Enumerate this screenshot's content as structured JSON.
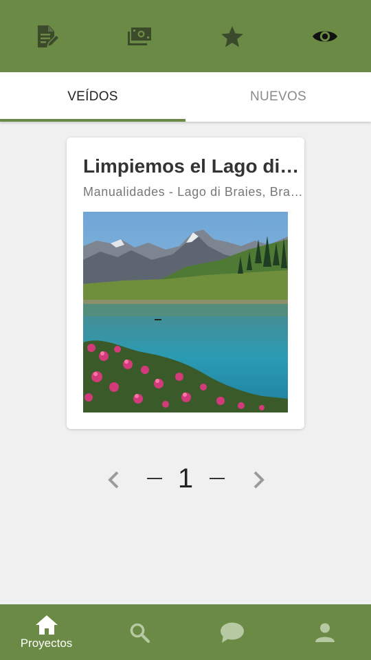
{
  "colors": {
    "primary": "#6a8a45",
    "icon_dark": "#3c4a2c",
    "icon_black": "#111111",
    "nav_icon_inactive": "#b7c9a2",
    "background": "#f0f0f0"
  },
  "toolbar": {
    "icons": [
      "edit-document-icon",
      "money-icon",
      "star-icon",
      "eye-icon"
    ]
  },
  "tabs": [
    {
      "label": "VEÍDOS",
      "active": true
    },
    {
      "label": "NUEVOS",
      "active": false
    }
  ],
  "card": {
    "title": "Limpiemos el Lago di Braies",
    "subtitle": "Manualidades - Lago di Braies, Braies"
  },
  "pagination": {
    "current_page": "1"
  },
  "bottom_nav": {
    "items": [
      {
        "icon": "home-icon",
        "label": "Proyectos",
        "active": true
      },
      {
        "icon": "search-icon",
        "label": "",
        "active": false
      },
      {
        "icon": "chat-icon",
        "label": "",
        "active": false
      },
      {
        "icon": "person-icon",
        "label": "",
        "active": false
      }
    ]
  }
}
